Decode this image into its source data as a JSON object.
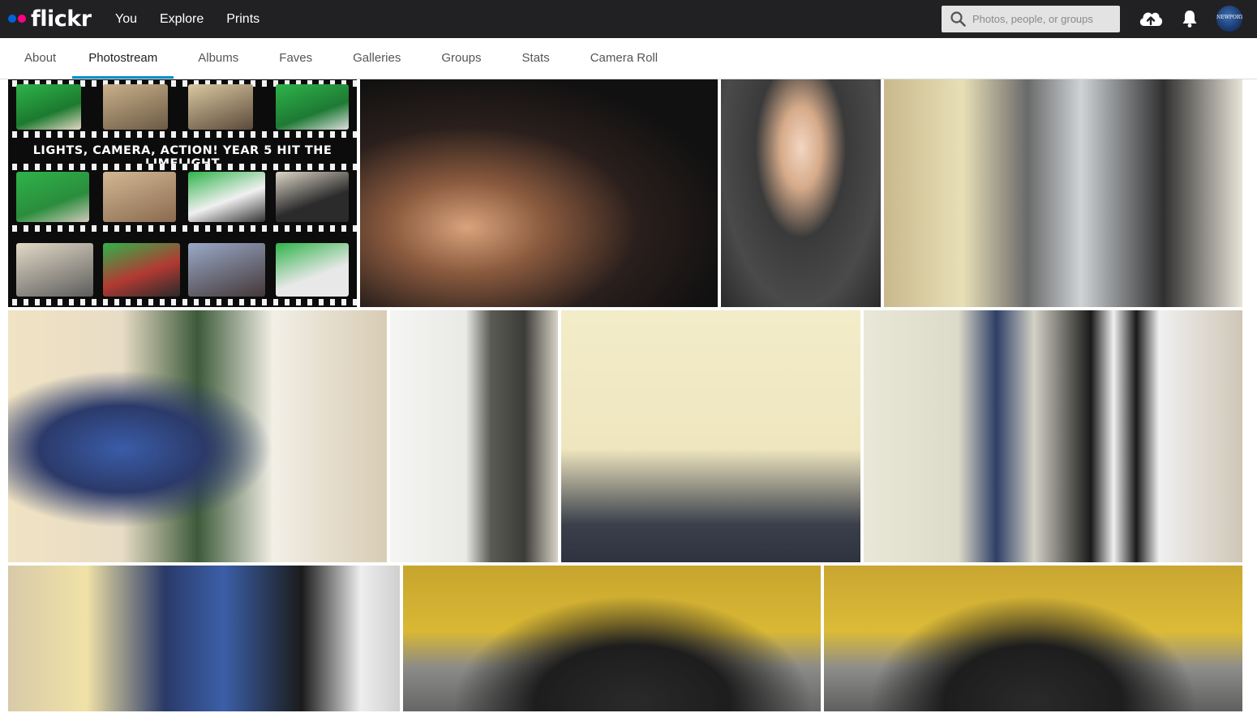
{
  "brand": {
    "name": "flickr",
    "dot1": "#0063dc",
    "dot2": "#ff0084"
  },
  "topnav": [
    {
      "label": "You"
    },
    {
      "label": "Explore"
    },
    {
      "label": "Prints"
    }
  ],
  "search": {
    "placeholder": "Photos, people, or groups",
    "icon": "search-icon"
  },
  "header_icons": {
    "upload": "cloud-upload-icon",
    "notifications": "bell-icon",
    "avatar": "avatar",
    "avatar_text": "NEWPORT"
  },
  "tabs": [
    {
      "label": "About",
      "active": false
    },
    {
      "label": "Photostream",
      "active": true
    },
    {
      "label": "Albums",
      "active": false
    },
    {
      "label": "Faves",
      "active": false
    },
    {
      "label": "Galleries",
      "active": false
    },
    {
      "label": "Groups",
      "active": false
    },
    {
      "label": "Stats",
      "active": false
    },
    {
      "label": "Camera Roll",
      "active": false
    }
  ],
  "accent_color": "#008ecf",
  "photos": [
    {
      "caption": "LIGHTS, CAMERA, ACTION! YEAR 5 HIT THE LIMELIGHT"
    },
    {
      "caption": ""
    },
    {
      "caption": ""
    },
    {
      "caption": ""
    },
    {
      "caption": ""
    },
    {
      "caption": ""
    },
    {
      "caption": ""
    },
    {
      "caption": ""
    },
    {
      "caption": ""
    },
    {
      "caption": ""
    },
    {
      "caption": ""
    }
  ]
}
